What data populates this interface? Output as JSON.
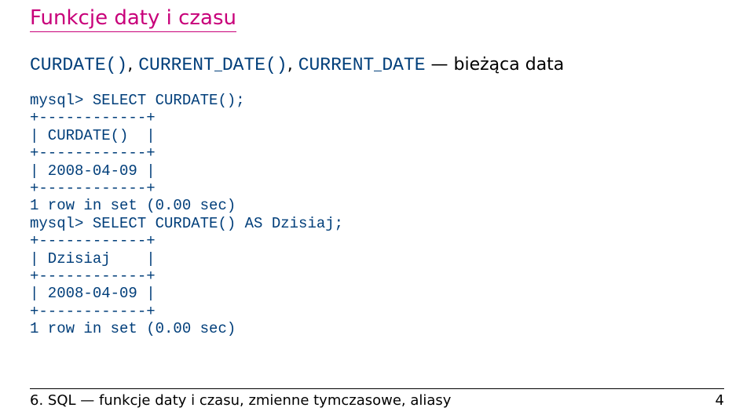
{
  "title": "Funkcje daty i czasu",
  "desc": {
    "fn1": "CURDATE()",
    "sep1": ", ",
    "fn2a": "CURRENT",
    "fn2b": "DATE()",
    "sep2": ", ",
    "fn3a": "CURRENT",
    "fn3b": "DATE",
    "tail": " — bieżąca data"
  },
  "code": "mysql> SELECT CURDATE();\n+------------+\n| CURDATE()  |\n+------------+\n| 2008-04-09 |\n+------------+\n1 row in set (0.00 sec)\nmysql> SELECT CURDATE() AS Dzisiaj;\n+------------+\n| Dzisiaj    |\n+------------+\n| 2008-04-09 |\n+------------+\n1 row in set (0.00 sec)",
  "footer": {
    "left": "6. SQL — funkcje daty i czasu, zmienne tymczasowe, aliasy",
    "page": "4"
  }
}
